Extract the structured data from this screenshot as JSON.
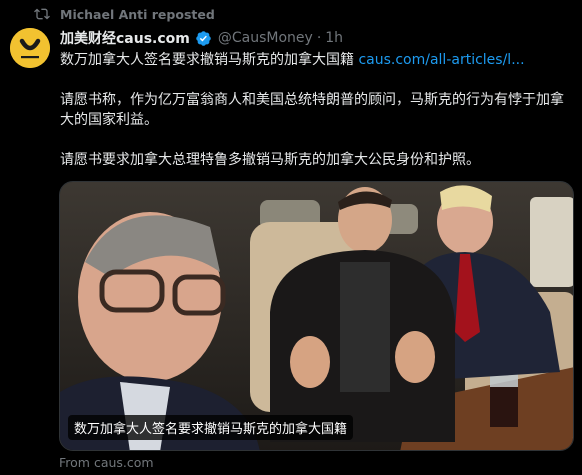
{
  "repost": {
    "text": "Michael Anti reposted",
    "icon": "repost-icon"
  },
  "author": {
    "display_name": "加美财经caus.com",
    "handle": "@CausMoney",
    "separator": "·",
    "time": "1h",
    "verified_color": "#1d9bf0",
    "avatar_color": "#f2c230"
  },
  "tweet": {
    "line1_text": "数万加拿大人签名要求撤销马斯克的加拿大国籍",
    "link_text": "caus.com/all-articles/l...",
    "paragraph2": "请愿书称，作为亿万富翁商人和美国总统特朗普的顾问，马斯克的行为有悖于加拿大的国家利益。",
    "paragraph3": "请愿书要求加拿大总理特鲁多撤销马斯克的加拿大公民身份和护照。"
  },
  "media": {
    "caption": "数万加拿大人签名要求撤销马斯克的加拿大国籍",
    "source": "From caus.com"
  },
  "colors": {
    "background": "#000000",
    "text": "#e7e9ea",
    "muted": "#71767b",
    "link": "#1d9bf0"
  }
}
